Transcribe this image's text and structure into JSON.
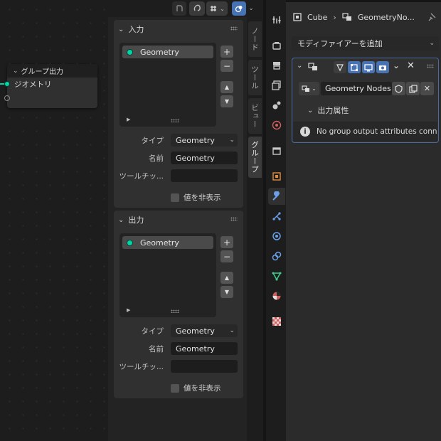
{
  "node_editor": {
    "group_output_node": {
      "title": "グループ出力",
      "socket_label": "ジオメトリ"
    }
  },
  "sidebar": {
    "tabs": [
      "ノード",
      "ツール",
      "ビュー",
      "グループ"
    ],
    "active_tab": "グループ",
    "inputs_panel": {
      "title": "入力",
      "items": [
        "Geometry"
      ],
      "type_label": "タイプ",
      "type_value": "Geometry",
      "name_label": "名前",
      "name_value": "Geometry",
      "tooltip_label": "ツールチッ...",
      "tooltip_value": "",
      "hide_value_label": "値を非表示",
      "add_symbol": "+",
      "remove_symbol": "−"
    },
    "outputs_panel": {
      "title": "出力",
      "items": [
        "Geometry"
      ],
      "type_label": "タイプ",
      "type_value": "Geometry",
      "name_label": "名前",
      "name_value": "Geometry",
      "tooltip_label": "ツールチッ...",
      "tooltip_value": "",
      "hide_value_label": "値を非表示",
      "add_symbol": "+",
      "remove_symbol": "−"
    }
  },
  "properties": {
    "breadcrumb": {
      "object": "Cube",
      "modifier": "GeometryNo..."
    },
    "add_modifier_label": "モディファイアーを追加",
    "modifier": {
      "node_group": "Geometry Nodes",
      "output_attributes_label": "出力属性",
      "info_message": "No group output attributes conn..."
    }
  },
  "colors": {
    "accent": "#4772b3",
    "geometry_socket": "#00d6a3",
    "panel_bg": "#303030",
    "background": "#1d1d1d"
  },
  "icons": {
    "header": [
      "undo-icon",
      "link-icon",
      "snap-icon",
      "overlay-icon"
    ],
    "property_tabs": [
      "tool-icon",
      "render-icon",
      "output-icon",
      "view-layer-icon",
      "scene-icon",
      "world-icon",
      "collection-icon",
      "object-icon",
      "modifier-icon",
      "particles-icon",
      "physics-icon",
      "constraints-icon",
      "data-icon",
      "material-icon",
      "texture-icon"
    ]
  }
}
